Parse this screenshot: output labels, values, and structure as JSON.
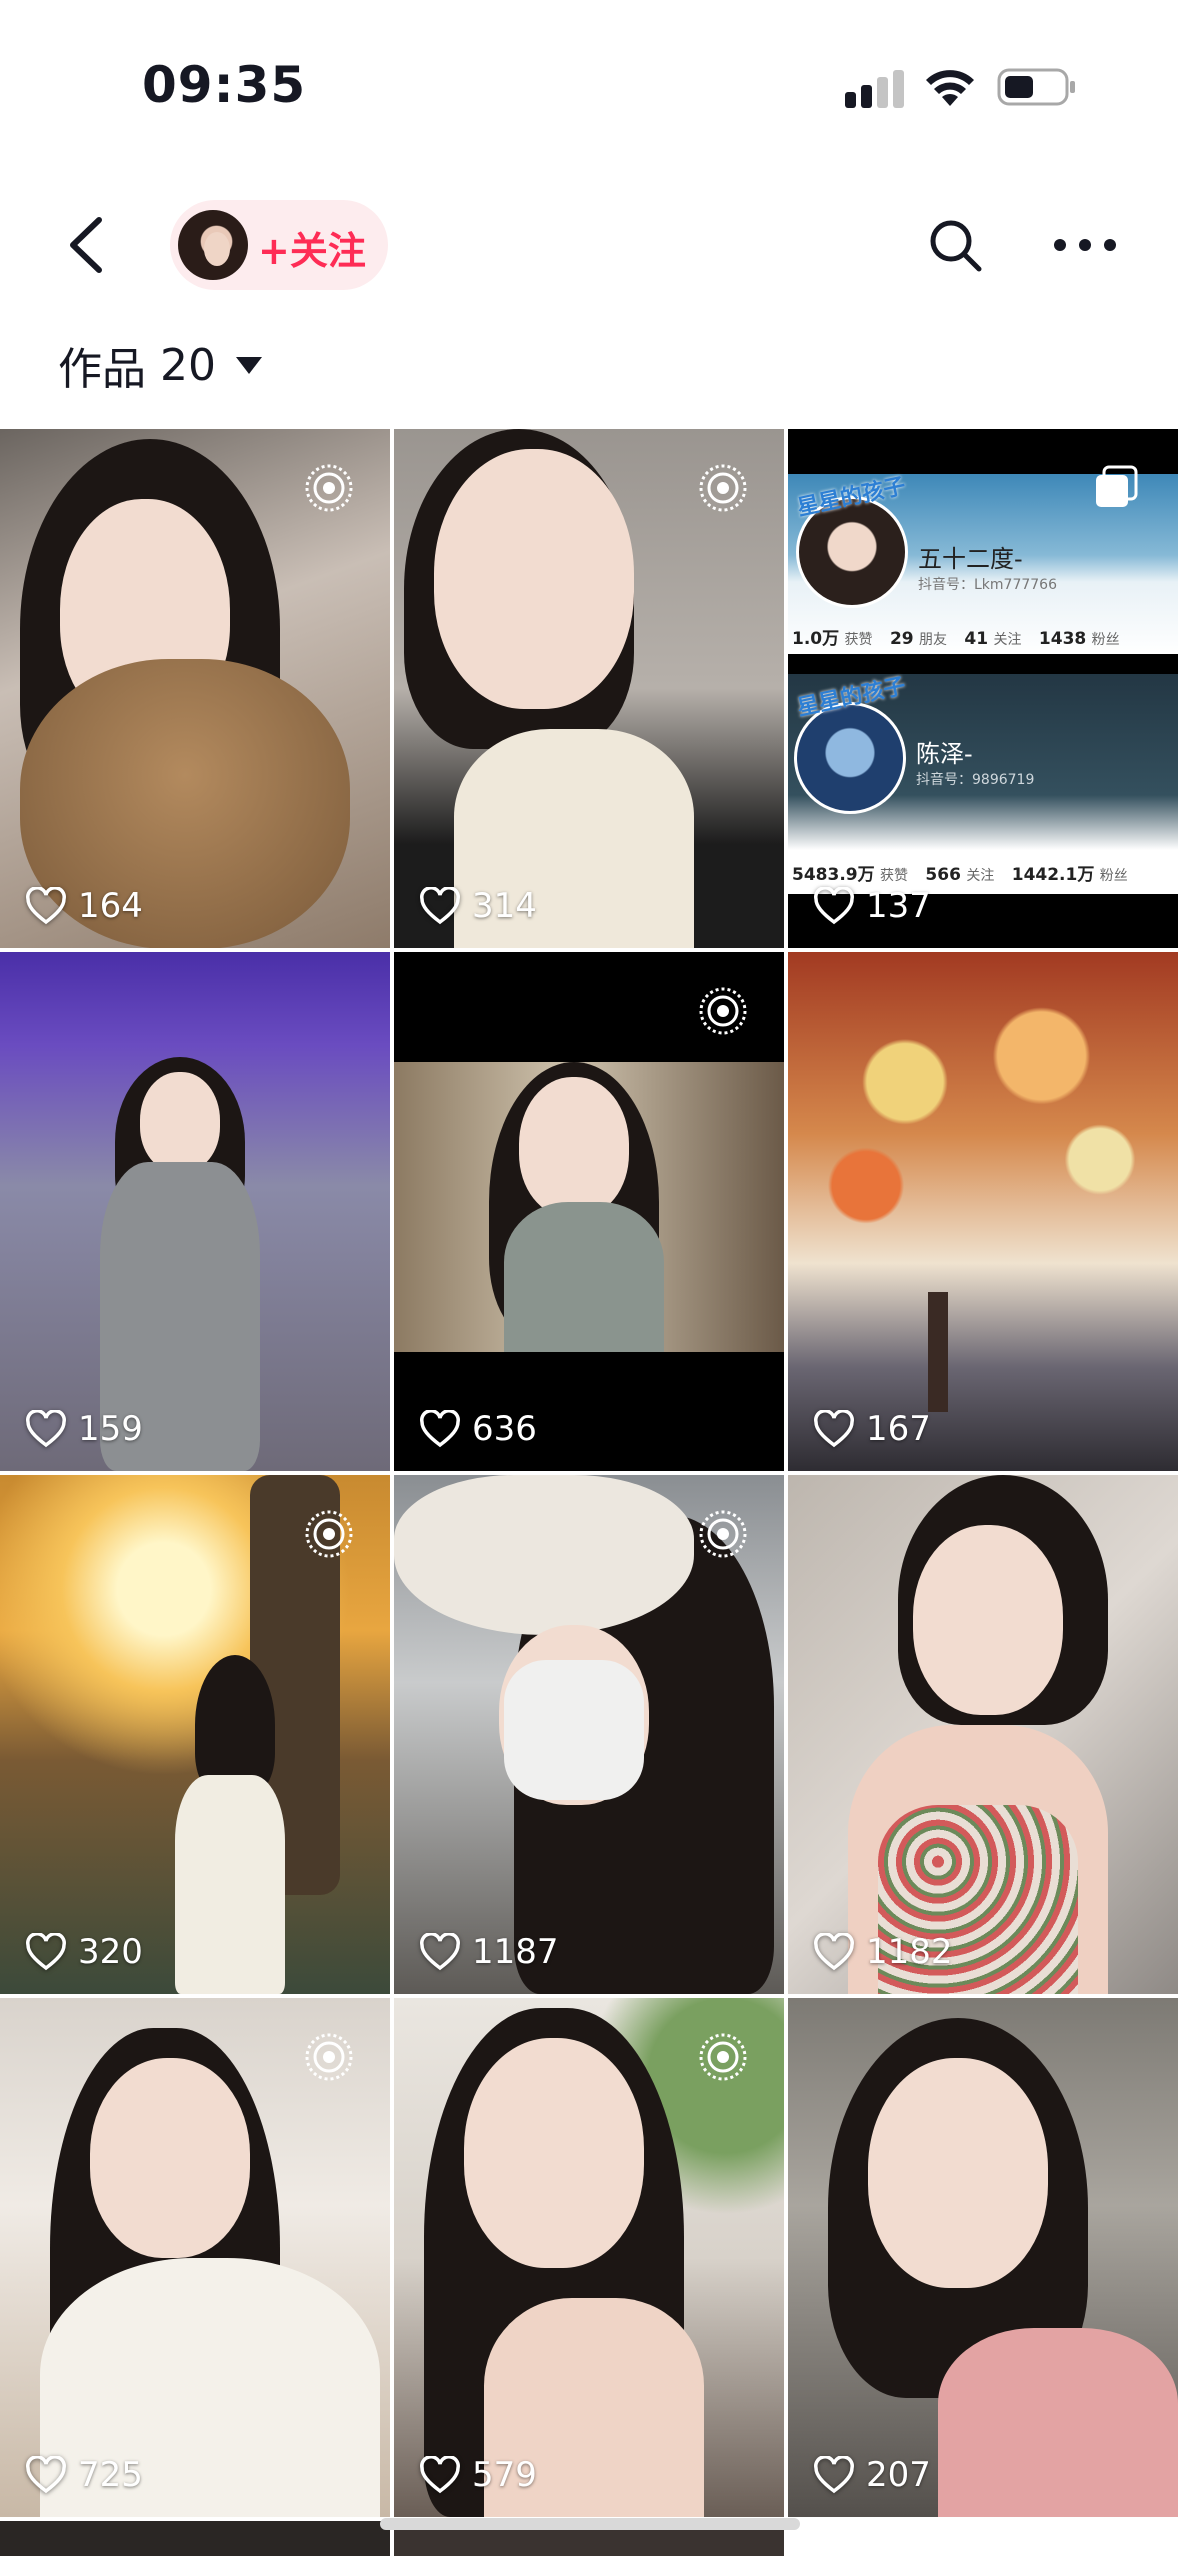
{
  "status_bar": {
    "time": "09:35"
  },
  "nav": {
    "follow_label": "+关注"
  },
  "works": {
    "label": "作品",
    "count": "20"
  },
  "tiles": [
    {
      "likes": "164",
      "badge": "live-photo-icon"
    },
    {
      "likes": "314",
      "badge": "live-photo-icon"
    },
    {
      "likes": "137",
      "badge": "multi-image-icon"
    },
    {
      "likes": "159",
      "badge": ""
    },
    {
      "likes": "636",
      "badge": "live-photo-icon"
    },
    {
      "likes": "167",
      "badge": ""
    },
    {
      "likes": "320",
      "badge": "live-photo-icon"
    },
    {
      "likes": "1187",
      "badge": "live-photo-icon"
    },
    {
      "likes": "1182",
      "badge": ""
    },
    {
      "likes": "725",
      "badge": "live-photo-icon"
    },
    {
      "likes": "579",
      "badge": "live-photo-icon"
    },
    {
      "likes": "207",
      "badge": ""
    }
  ],
  "screenshot_tile": {
    "card1": {
      "name": "五十二度-",
      "id": "抖音号：Lkm777766",
      "stats": [
        {
          "value": "1.0万",
          "label": "获赞"
        },
        {
          "value": "29",
          "label": "朋友"
        },
        {
          "value": "41",
          "label": "关注"
        },
        {
          "value": "1438",
          "label": "粉丝"
        }
      ]
    },
    "card2": {
      "name": "陈泽-",
      "id": "抖音号：9896719",
      "stats": [
        {
          "value": "5483.9万",
          "label": "获赞"
        },
        {
          "value": "566",
          "label": "关注"
        },
        {
          "value": "1442.1万",
          "label": "粉丝"
        }
      ]
    },
    "sticker": "星星的孩子"
  },
  "colors": {
    "accent": "#fe2c55",
    "follow_bg": "#fdecee"
  }
}
